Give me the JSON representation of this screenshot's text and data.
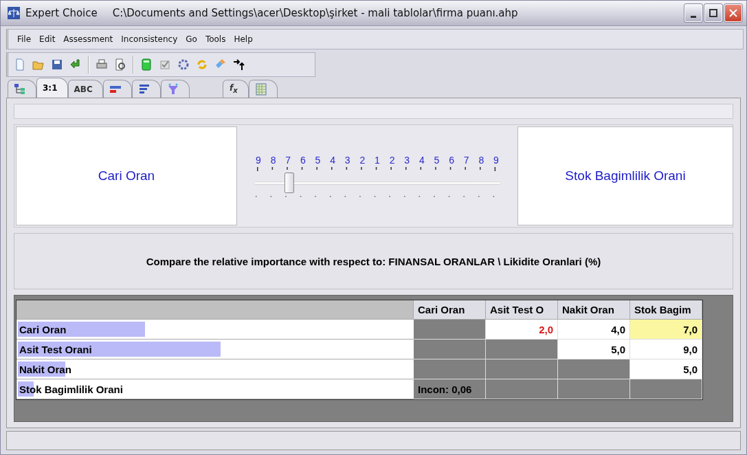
{
  "window": {
    "app": "Expert Choice",
    "path": "C:\\Documents and Settings\\acer\\Desktop\\şirket - mali tablolar\\firma puanı.ahp"
  },
  "menu": [
    "File",
    "Edit",
    "Assessment",
    "Inconsistency",
    "Go",
    "Tools",
    "Help"
  ],
  "tabs": [
    {
      "kind": "tree",
      "selected": false
    },
    {
      "kind": "text",
      "label": "3:1",
      "selected": true
    },
    {
      "kind": "text",
      "label": "ABC",
      "selected": false
    },
    {
      "kind": "bar-pair",
      "selected": false
    },
    {
      "kind": "bars",
      "selected": false
    },
    {
      "kind": "funnel",
      "selected": false
    },
    {
      "kind": "text",
      "label": "f$_{x}$",
      "italic": true,
      "gap_before": true,
      "selected": false
    },
    {
      "kind": "grid",
      "selected": false
    }
  ],
  "comparison": {
    "left": "Cari Oran",
    "right": "Stok Bagimlilik Orani",
    "scale": [
      "9",
      "8",
      "7",
      "6",
      "5",
      "4",
      "3",
      "2",
      "1",
      "2",
      "3",
      "4",
      "5",
      "6",
      "7",
      "8",
      "9"
    ],
    "level": 0.125
  },
  "prompt": "Compare the relative importance with respect to: FINANSAL ORANLAR \\ Likidite Oranlari (%)",
  "matrix": {
    "columns": [
      "Cari Oran",
      "Asit Test O",
      "Nakit Oran",
      "Stok Bagim"
    ],
    "rows": [
      {
        "label": "Cari Oran",
        "level": 0.32,
        "cells": [
          {
            "kind": "blocked"
          },
          {
            "kind": "value",
            "text": "2,0",
            "inverse": true,
            "selected": false
          },
          {
            "kind": "value",
            "text": "4,0",
            "inverse": false,
            "selected": false
          },
          {
            "kind": "value",
            "text": "7,0",
            "inverse": false,
            "selected": true
          }
        ]
      },
      {
        "label": "Asit Test Orani",
        "level": 0.51,
        "cells": [
          {
            "kind": "blocked"
          },
          {
            "kind": "blocked"
          },
          {
            "kind": "value",
            "text": "5,0",
            "inverse": false,
            "selected": false
          },
          {
            "kind": "value",
            "text": "9,0",
            "inverse": false,
            "selected": false
          }
        ]
      },
      {
        "label": "Nakit Oran",
        "level": 0.12,
        "cells": [
          {
            "kind": "blocked"
          },
          {
            "kind": "blocked"
          },
          {
            "kind": "blocked"
          },
          {
            "kind": "value",
            "text": "5,0",
            "inverse": false,
            "selected": false
          }
        ]
      },
      {
        "label": "Stok Bagimlilik Orani",
        "level": 0.04,
        "cells": [
          {
            "kind": "note",
            "text": "Incon: 0,06"
          },
          {
            "kind": "blocked"
          },
          {
            "kind": "blocked"
          },
          {
            "kind": "blocked"
          }
        ]
      }
    ]
  }
}
